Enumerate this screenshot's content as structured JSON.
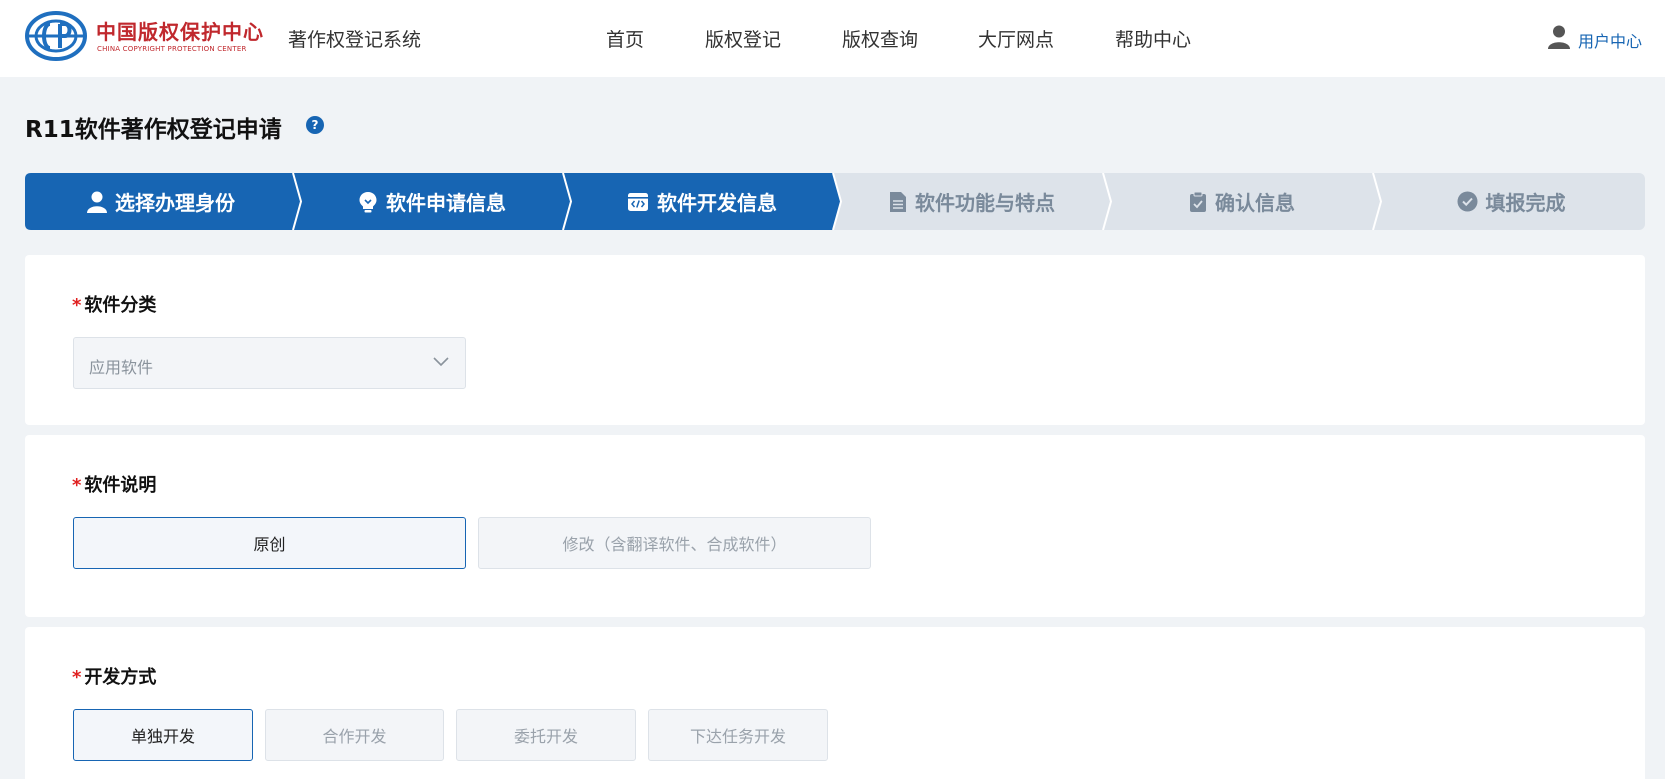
{
  "header": {
    "logo_cn": "中国版权保护中心",
    "logo_en": "CHINA COPYRIGHT PROTECTION CENTER",
    "system_name": "著作权登记系统",
    "nav": [
      "首页",
      "版权登记",
      "版权查询",
      "大厅网点",
      "帮助中心"
    ],
    "user_label": "用户中心"
  },
  "page": {
    "title": "R11软件著作权登记申请",
    "help_symbol": "?"
  },
  "steps": [
    {
      "label": "选择办理身份",
      "icon": "user-icon",
      "state": "completed"
    },
    {
      "label": "软件申请信息",
      "icon": "bulb-icon",
      "state": "completed"
    },
    {
      "label": "软件开发信息",
      "icon": "code-window-icon",
      "state": "current"
    },
    {
      "label": "软件功能与特点",
      "icon": "document-icon",
      "state": "pending"
    },
    {
      "label": "确认信息",
      "icon": "clipboard-check-icon",
      "state": "pending"
    },
    {
      "label": "填报完成",
      "icon": "check-circle-icon",
      "state": "pending"
    }
  ],
  "form": {
    "category": {
      "required_mark": "*",
      "label": "软件分类",
      "value": "应用软件"
    },
    "description": {
      "required_mark": "*",
      "label": "软件说明",
      "options": [
        "原创",
        "修改（含翻译软件、合成软件）"
      ],
      "selected": "原创"
    },
    "dev_method": {
      "required_mark": "*",
      "label": "开发方式",
      "options": [
        "单独开发",
        "合作开发",
        "委托开发",
        "下达任务开发"
      ],
      "selected": "单独开发"
    }
  },
  "colors": {
    "primary": "#1765b3",
    "step_inactive_bg": "#dde3ea",
    "step_inactive_text": "#7a8a9b",
    "required": "#e02020",
    "logo_red": "#c0282d"
  }
}
